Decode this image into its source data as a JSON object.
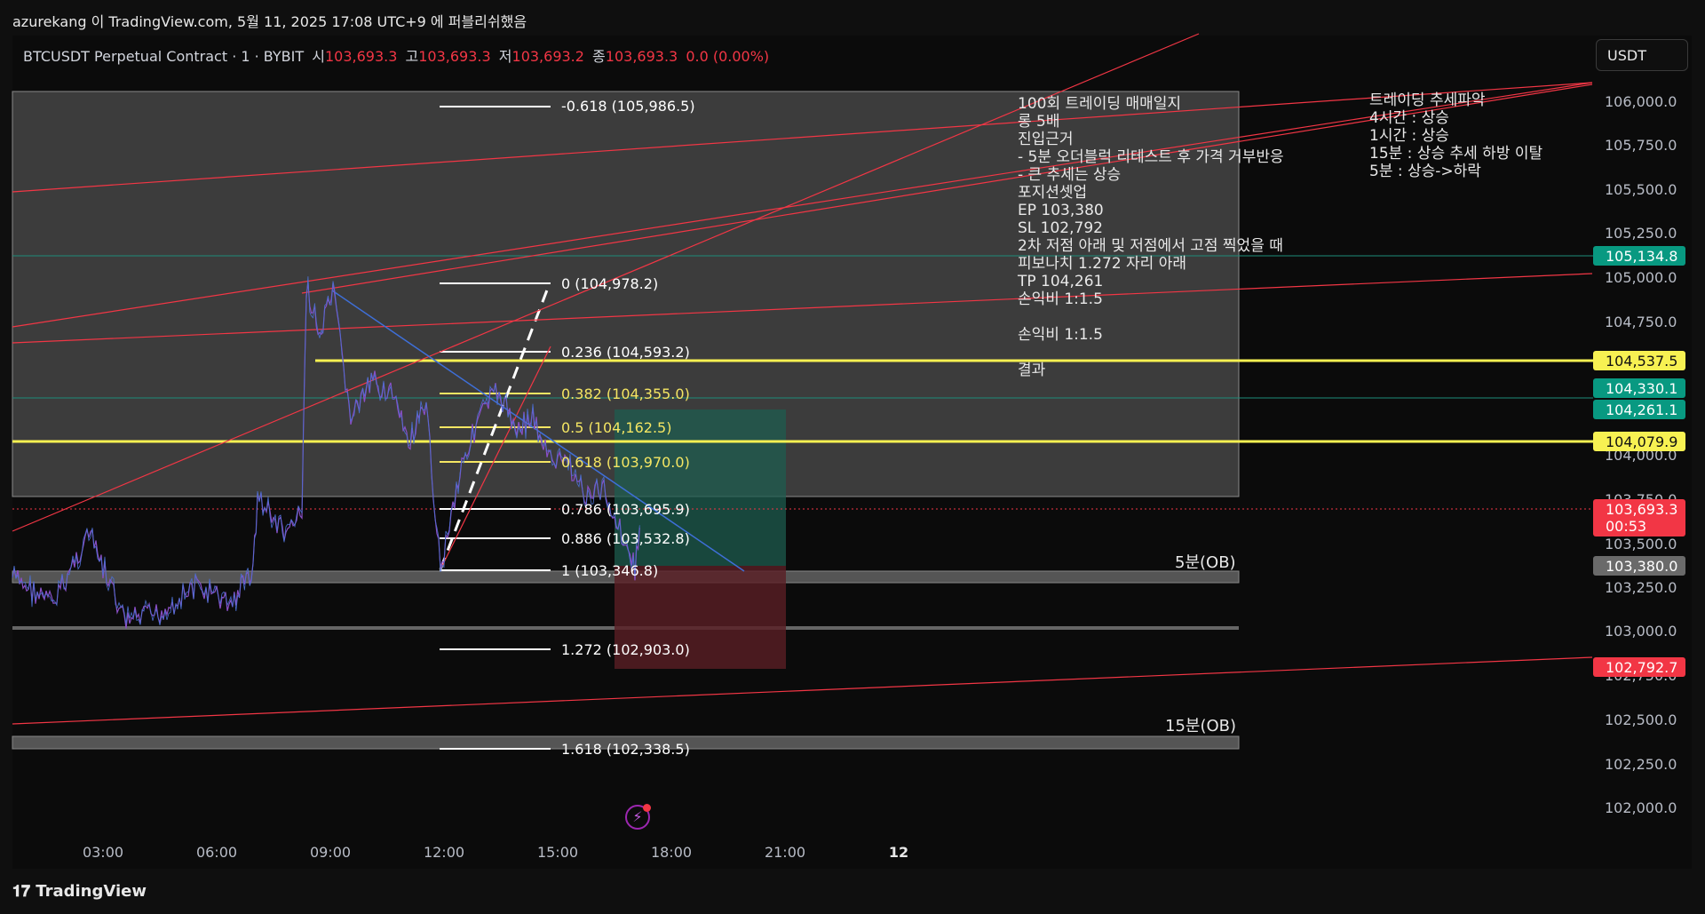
{
  "publish_line": "azurekang 이 TradingView.com, 5월 11, 2025 17:08 UTC+9 에 퍼블리쉬했음",
  "legend": {
    "symbol": "BTCUSDT Perpetual Contract · 1 · BYBIT",
    "open_label": "시",
    "open": "103,693.3",
    "high_label": "고",
    "high": "103,693.3",
    "low_label": "저",
    "low": "103,693.2",
    "close_label": "종",
    "close": "103,693.3",
    "change": "0.0 (0.00%)"
  },
  "currency_button": "USDT",
  "price_axis": [
    "106,000.0",
    "105,750.0",
    "105,500.0",
    "105,250.0",
    "105,000.0",
    "104,750.0",
    "104,000.0",
    "103,750.0",
    "103,500.0",
    "103,250.0",
    "103,000.0",
    "102,750.0",
    "102,500.0",
    "102,250.0",
    "102,000.0"
  ],
  "time_axis": [
    "03:00",
    "06:00",
    "09:00",
    "12:00",
    "15:00",
    "18:00",
    "21:00",
    "12"
  ],
  "price_labels": {
    "p105134": "105,134.8",
    "p104537": "104,537.5",
    "p104330": "104,330.1",
    "p104261": "104,261.1",
    "p104079": "104,079.9",
    "last_price": "103,693.3",
    "countdown": "00:53",
    "p103380": "103,380.0",
    "p102792": "102,792.7"
  },
  "fib_levels": [
    {
      "label": "-0.618 (105,986.5)",
      "color": "#ffffff"
    },
    {
      "label": "0 (104,978.2)",
      "color": "#ffffff"
    },
    {
      "label": "0.236 (104,593.2)",
      "color": "#ffffff"
    },
    {
      "label": "0.382 (104,355.0)",
      "color": "#f5e663"
    },
    {
      "label": "0.5 (104,162.5)",
      "color": "#f5e663"
    },
    {
      "label": "0.618 (103,970.0)",
      "color": "#f5e663"
    },
    {
      "label": "0.786 (103,695.9)",
      "color": "#ffffff"
    },
    {
      "label": "0.886 (103,532.8)",
      "color": "#ffffff"
    },
    {
      "label": "1 (103,346.8)",
      "color": "#ffffff"
    },
    {
      "label": "1.272 (102,903.0)",
      "color": "#ffffff"
    },
    {
      "label": "1.618 (102,338.5)",
      "color": "#ffffff"
    }
  ],
  "trade_note": {
    "l1": "100회 트레이딩 매매일지",
    "l2": "롱 5배",
    "l3": "진입근거",
    "l4": "- 5분 오더블럭 리테스트 후 가격 거부반응",
    "l5": "- 큰 추세는 상승",
    "l6": "포지션셋업",
    "l7": "EP 103,380",
    "l8": "SL 102,792",
    "l9": "2차 저점 아래 및 저점에서 고점 찍었을 때",
    "l10": "피보나치 1.272 자리 아래",
    "l11": "TP 104,261",
    "l12": "손익비 1:1.5",
    "l13": "손익비 1:1.5",
    "l14": "결과"
  },
  "trend_note": {
    "l1": "트레이딩 추세파악",
    "l2": "4시간 : 상승",
    "l3": "1시간 : 상승",
    "l4": "15분 : 상승 추세 하방 이탈",
    "l5": "5분 : 상승->하락"
  },
  "ob_labels": {
    "ob5": "5분(OB)",
    "ob15": "15분(OB)"
  },
  "footer_logo": "TradingView",
  "colors": {
    "red": "#f23645",
    "green": "#089981",
    "yellow": "#f7f152",
    "blue": "#3e6fd8",
    "teal_line": "#1e8c7a"
  }
}
